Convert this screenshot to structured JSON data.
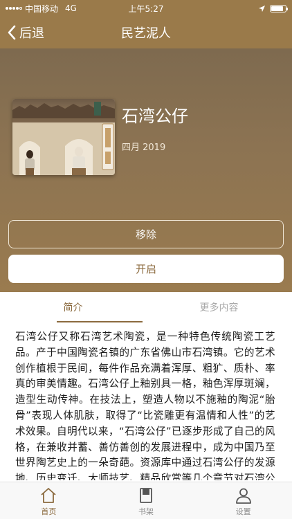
{
  "status_bar": {
    "carrier": "中国移动",
    "network": "4G",
    "time": "上午5:27"
  },
  "nav": {
    "back_label": "后退",
    "title": "民艺泥人"
  },
  "book": {
    "title": "石湾公仔",
    "date": "四月 2019"
  },
  "actions": {
    "remove_label": "移除",
    "open_label": "开启"
  },
  "tabs": {
    "intro_label": "简介",
    "more_label": "更多内容"
  },
  "intro_text": "石湾公仔又称石湾艺术陶瓷，是一种特色传统陶瓷工艺品。产于中国陶瓷名镇的广东省佛山市石湾镇。它的艺术创作植根于民间，每件作品充满着浑厚、粗犷、质朴、率真的审美情趣。石湾公仔上釉别具一格，釉色浑厚斑斓，造型生动传神。在技法上，塑造人物以不施釉的陶泥“胎骨”表现人体肌肤，取得了“比瓷雕更有温情和人性”的艺术效果。自明代以来，“石湾公仔”已逐步形成了自己的风格，在兼收并蓄、善仿善创的发展进程中，成为中国乃至世界陶艺史上的一朵奇葩。资源库中通过石湾公仔的发源地、历史变迁、大师技艺、精品欣赏等几个章节对石湾公仔进行了介绍。",
  "tab_bar": {
    "home_label": "首页",
    "shelf_label": "书架",
    "settings_label": "设置"
  },
  "colors": {
    "brand": "#9a7a4a",
    "accent": "#8b6a3e",
    "inactive": "#a8a8a8"
  },
  "battery_level": 0.85
}
